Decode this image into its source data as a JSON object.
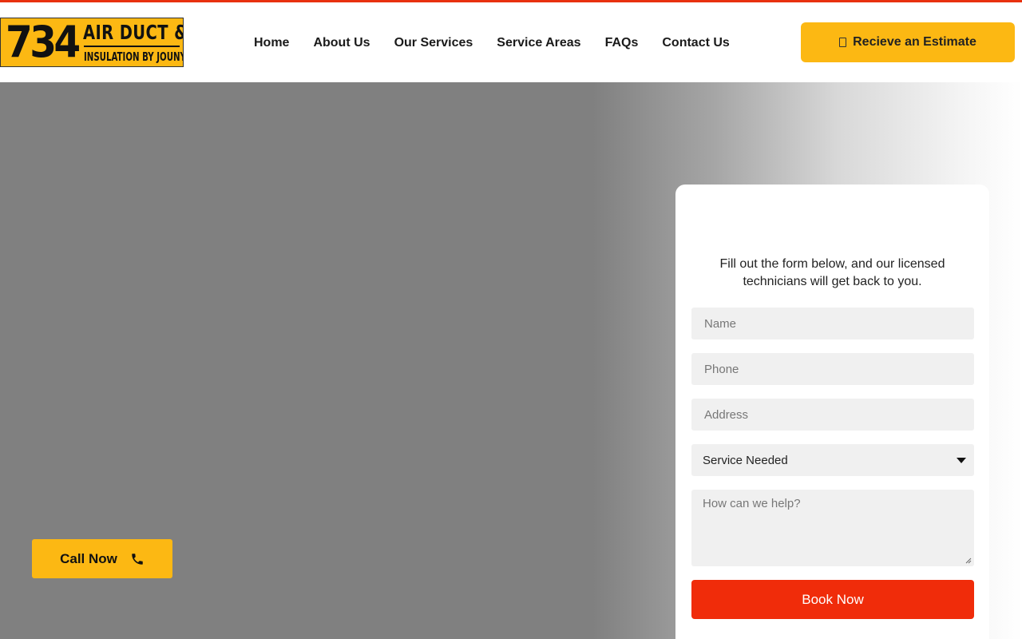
{
  "logo": {
    "number": "734",
    "line1": "AIR DUCT &",
    "line2": "INSULATION BY JOUNY",
    "color": "#fcb813"
  },
  "nav": {
    "items": [
      {
        "label": "Home"
      },
      {
        "label": "About Us"
      },
      {
        "label": "Our Services"
      },
      {
        "label": "Service Areas"
      },
      {
        "label": "FAQs"
      },
      {
        "label": "Contact Us"
      }
    ]
  },
  "header": {
    "cta_label": "Recieve an Estimate",
    "cta_icon": "document-icon"
  },
  "hero": {
    "call_label": "Call Now",
    "call_icon": "phone-icon"
  },
  "form": {
    "intro": "Fill out the form below, and our licensed technicians will get back to you.",
    "name_placeholder": "Name",
    "phone_placeholder": "Phone",
    "address_placeholder": "Address",
    "service_selected": "Service Needed",
    "message_placeholder": "How can we help?",
    "submit_label": "Book Now"
  },
  "colors": {
    "accent": "#fcb813",
    "brand_red": "#f02c0a",
    "top_bar": "#e8310f"
  }
}
